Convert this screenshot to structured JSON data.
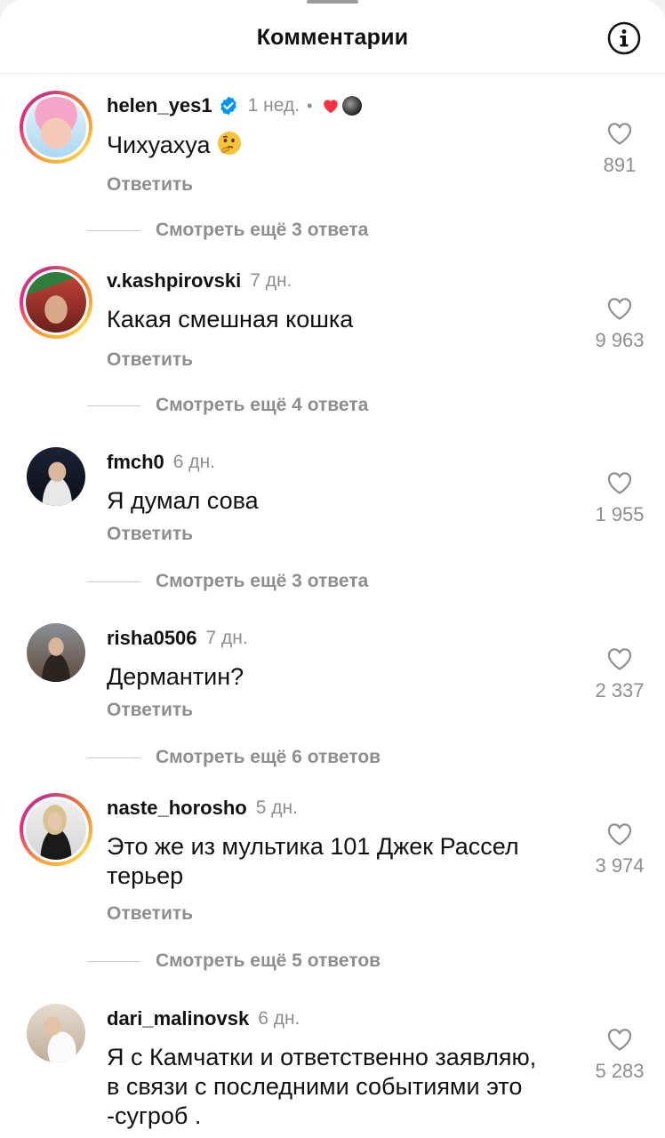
{
  "header": {
    "title": "Комментарии",
    "info_icon": "info-icon"
  },
  "comments": [
    {
      "username": "helen_yes1",
      "verified": true,
      "time": "1 нед.",
      "creator_liked": true,
      "text": "Чихуахуа",
      "emoji": "thinking-face",
      "reply_label": "Ответить",
      "likes": "891",
      "more_replies": "Смотреть ещё 3 ответа"
    },
    {
      "username": "v.kashpirovski",
      "time": "7 дн.",
      "text": "Какая смешная кошка",
      "reply_label": "Ответить",
      "likes": "9 963",
      "more_replies": "Смотреть ещё 4 ответа"
    },
    {
      "username": "fmch0",
      "time": "6 дн.",
      "text": "Я думал сова",
      "reply_label": "Ответить",
      "likes": "1 955",
      "more_replies": "Смотреть ещё 3 ответа"
    },
    {
      "username": "risha0506",
      "time": "7 дн.",
      "text": "Дермантин?",
      "reply_label": "Ответить",
      "likes": "2 337",
      "more_replies": "Смотреть ещё 6 ответов"
    },
    {
      "username": "naste_horosho",
      "time": "5 дн.",
      "text": "Это же из мультика 101 Джек Рассел терьер",
      "reply_label": "Ответить",
      "likes": "3 974",
      "more_replies": "Смотреть ещё 5 ответов"
    },
    {
      "username": "dari_malinovsk",
      "time": "6 дн.",
      "text": "Я с Камчатки и ответственно заявляю, в связи с последними событиями это -сугроб .",
      "likes": "5 283"
    }
  ],
  "colors": {
    "secondary_text": "#8e8e8e",
    "heart_red": "#ff3040",
    "verified_blue": "#0095f6"
  }
}
